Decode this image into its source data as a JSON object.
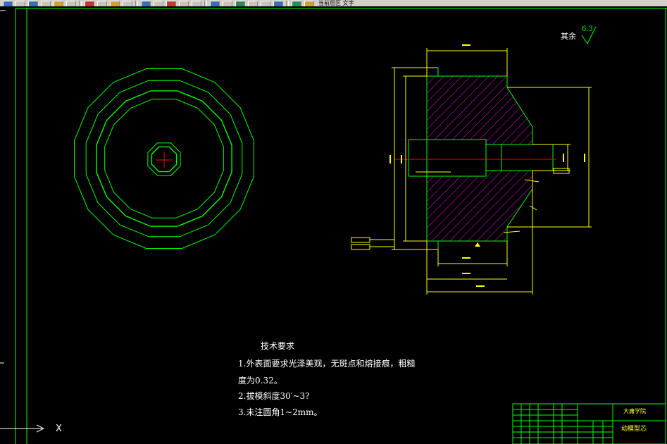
{
  "toolbar": {
    "status_text": "当前层区 文字"
  },
  "drawing": {
    "roughness_label": "其余",
    "roughness_value": "6.3",
    "tech_req_title": "技术要求",
    "tech_req_lines": [
      "1.外表面要求光泽美观，无斑点和熔接痕，粗糙",
      "度为0.32。",
      "2.拔模斜度30′~3?",
      "3.未注圆角1~2mm。"
    ],
    "ucs_label": "X"
  },
  "title_block": {
    "school": "大庸学院",
    "part_name": "动模型芯"
  },
  "colors": {
    "background": "#000000",
    "frame": "#00ff00",
    "outline": "#00ff00",
    "dimension": "#ffff00",
    "hatch": "#ff00ff",
    "centerline": "#ff0000",
    "text": "#ffffff"
  }
}
